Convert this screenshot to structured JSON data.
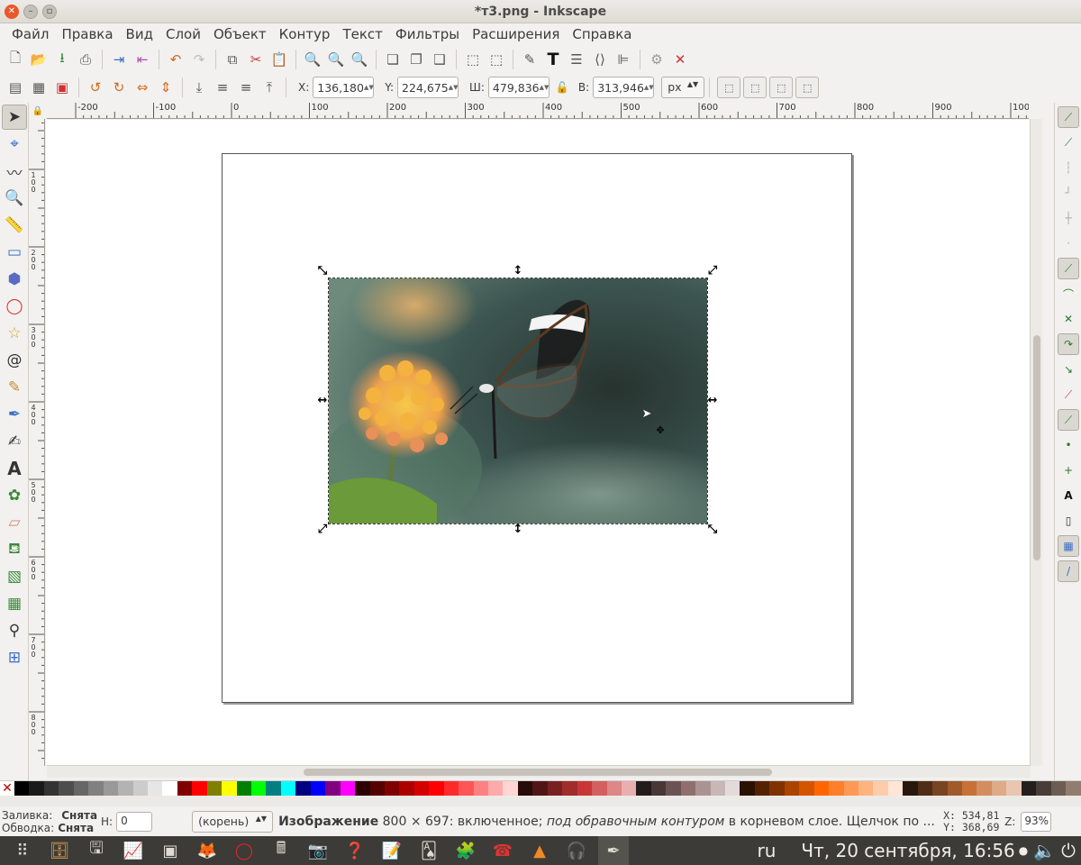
{
  "window": {
    "title": "*т3.png - Inkscape"
  },
  "menu": [
    "Файл",
    "Правка",
    "Вид",
    "Слой",
    "Объект",
    "Контур",
    "Текст",
    "Фильтры",
    "Расширения",
    "Справка"
  ],
  "controls": {
    "x_label": "X:",
    "x_value": "136,180",
    "y_label": "Y:",
    "y_value": "224,675",
    "w_label": "Ш:",
    "w_value": "479,836",
    "h_label": "В:",
    "h_value": "313,946",
    "unit": "px"
  },
  "ruler": {
    "top": [
      "-200",
      "-100",
      "0",
      "100",
      "200",
      "300",
      "400",
      "500",
      "600",
      "700",
      "800",
      "900",
      "1000"
    ],
    "left": [
      "0",
      "100",
      "200",
      "300",
      "400",
      "500",
      "600",
      "700",
      "800",
      "900"
    ]
  },
  "status": {
    "fill_label": "Заливка:",
    "fill_value": "Снята",
    "stroke_label": "Обводка:",
    "stroke_value": "Снята",
    "h_label": "Н:",
    "h_value": "0",
    "layer": "(корень)",
    "message_bold": "Изображение",
    "message_rest": " 800 × 697: включенное; ",
    "message_italic": "под обравочным контуром",
    "message_tail": " в корневом слое. Щелчок по ...",
    "x_coord": "X:  534,81",
    "y_coord": "Y:  368,69",
    "zoom_label": "Z:",
    "zoom_value": "93%"
  },
  "taskbar": {
    "lang": "ru",
    "datetime": "Чт, 20 сентября, 16:56"
  },
  "palette": [
    "#000000",
    "#1a1a1a",
    "#333333",
    "#4d4d4d",
    "#666666",
    "#808080",
    "#999999",
    "#b3b3b3",
    "#cccccc",
    "#e6e6e6",
    "#ffffff",
    "#800000",
    "#ff0000",
    "#808000",
    "#ffff00",
    "#008000",
    "#00ff00",
    "#008080",
    "#00ffff",
    "#000080",
    "#0000ff",
    "#800080",
    "#ff00ff",
    "#2b0000",
    "#550000",
    "#800000",
    "#aa0000",
    "#d40000",
    "#ff0000",
    "#ff2a2a",
    "#ff5555",
    "#ff8080",
    "#ffaaaa",
    "#ffd5d5",
    "#280b0b",
    "#501616",
    "#782121",
    "#a02c2c",
    "#c83737",
    "#d35f5f",
    "#de8787",
    "#e9afaf",
    "#241c1c",
    "#483737",
    "#6c5353",
    "#916f6f",
    "#ac9393",
    "#c8b7b7",
    "#e3dbdb",
    "#2b1100",
    "#552200",
    "#803300",
    "#aa4400",
    "#d45500",
    "#ff6600",
    "#ff7f2a",
    "#ff9955",
    "#ffb380",
    "#ffccaa",
    "#ffe6d5",
    "#28170b",
    "#502d16",
    "#784421",
    "#a05a2c",
    "#c87137",
    "#d38d5f",
    "#deaa87",
    "#e9c6af",
    "#241f1c",
    "#483e37",
    "#6c5d53",
    "#917c6f"
  ]
}
